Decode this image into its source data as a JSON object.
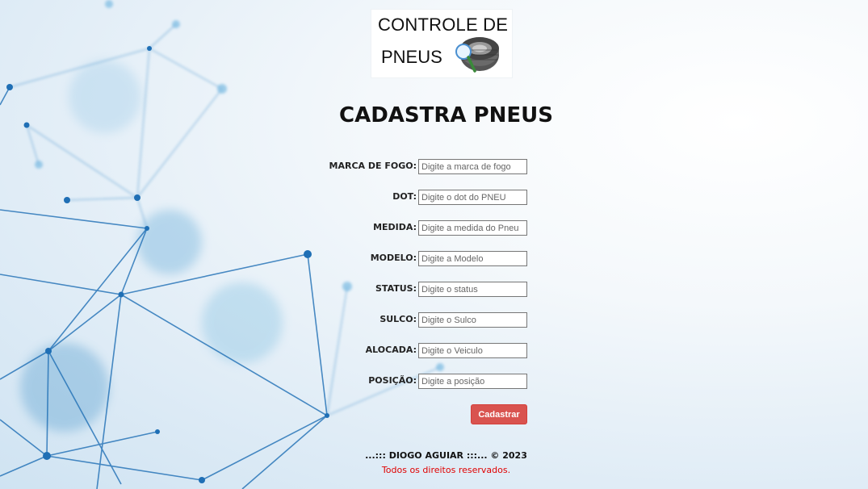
{
  "logo": {
    "line1": "CONTROLE DE",
    "line2": "PNEUS",
    "icon": "tire-magnifier-icon"
  },
  "page_title": "CADASTRA PNEUS",
  "form": {
    "fields": [
      {
        "label": "MARCA DE FOGO:",
        "placeholder": "Digite a marca de fogo",
        "value": ""
      },
      {
        "label": "DOT:",
        "placeholder": "Digite o dot do PNEU",
        "value": ""
      },
      {
        "label": "MEDIDA:",
        "placeholder": "Digite a medida do Pneu",
        "value": ""
      },
      {
        "label": "MODELO:",
        "placeholder": "Digite a Modelo",
        "value": ""
      },
      {
        "label": "STATUS:",
        "placeholder": "Digite o status",
        "value": ""
      },
      {
        "label": "SULCO:",
        "placeholder": "Digite o Sulco",
        "value": ""
      },
      {
        "label": "ALOCADA:",
        "placeholder": "Digite o Veiculo",
        "value": ""
      },
      {
        "label": "POSIÇÃO:",
        "placeholder": "Digite a posição",
        "value": ""
      }
    ],
    "submit_label": "Cadastrar"
  },
  "footer": {
    "credit": "...::: DIOGO AGUIAR :::... © 2023",
    "rights": "Todos os direitos reservados."
  },
  "colors": {
    "submit_button": "#d9534f",
    "rights_text": "#e00000",
    "network_lines": "#2f7fc0"
  }
}
